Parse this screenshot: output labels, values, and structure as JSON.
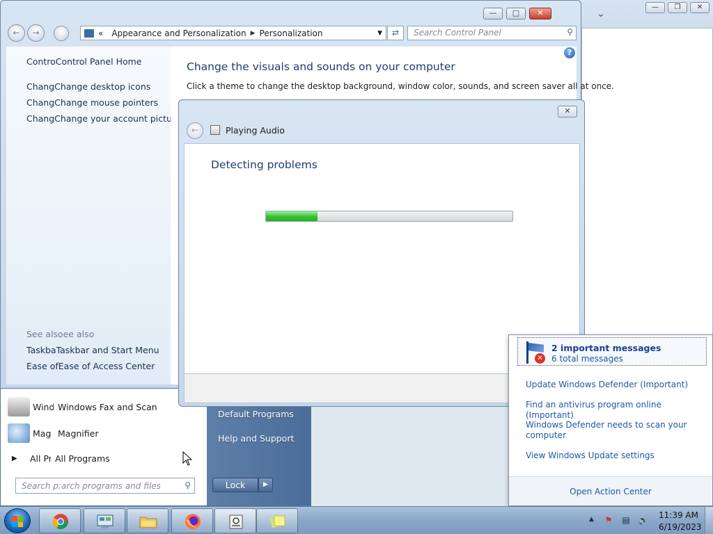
{
  "control_panel": {
    "breadcrumb": [
      "«",
      "Appearance and Personalization",
      "Personalization"
    ],
    "search_placeholder": "Search Control Panel",
    "left_links": [
      "ControControl Panel Home",
      "ChangChange desktop icons",
      "ChangChange mouse pointers",
      "ChangChange your account picture"
    ],
    "see_also_label": "See alsoee also",
    "see_also_links": [
      "TaskbaTaskbar and Start Menu",
      "Ease ofEase of Access Center"
    ],
    "main_heading": "Change the visuals and sounds on your computer",
    "main_description": "Click a theme to change the desktop background, window color, sounds, and screen saver all at once."
  },
  "dialog": {
    "title": "Playing Audio",
    "heading": "Detecting problems",
    "progress_fraction": 0.21
  },
  "start_menu": {
    "items": [
      {
        "truncated": "Wind",
        "label": "Windows Fax and Scan",
        "icon": "fax-scanner-icon"
      },
      {
        "truncated": "Mag",
        "label": "Magnifier",
        "icon": "magnifier-icon"
      },
      {
        "truncated": "All Pr",
        "label": "All Programs",
        "icon": "triangle-right-icon"
      }
    ],
    "right_items": [
      "Default Programs",
      "Help and Support"
    ],
    "search_placeholder": "Search p:arch programs and files",
    "lock_label": "Lock"
  },
  "action_center": {
    "title": "2 important messages",
    "subtitle": "6 total messages",
    "links": [
      "Update Windows Defender (Important)",
      "Find an antivirus program online (Important)",
      "Windows Defender needs to scan your computer",
      "View Windows Update settings"
    ],
    "footer": "Open Action Center"
  },
  "taskbar": {
    "apps": [
      "chrome-icon",
      "control-panel-icon",
      "file-explorer-icon",
      "firefox-icon",
      "troubleshooter-icon",
      "sticky-notes-icon"
    ],
    "time": "11:39 AM",
    "date": "6/19/2023"
  },
  "colors": {
    "link_blue": "#1e58a8",
    "heading_blue": "#1e3e6e",
    "progress_green": "#34c131"
  }
}
